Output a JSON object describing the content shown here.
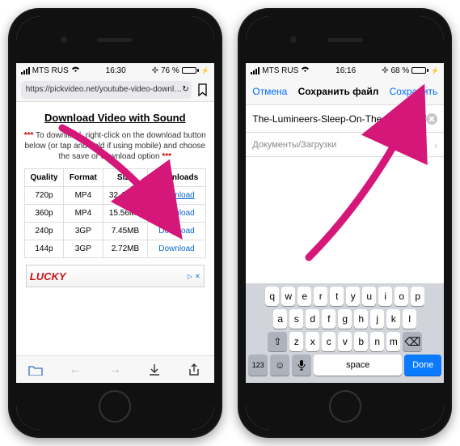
{
  "left": {
    "status": {
      "carrier": "MTS RUS",
      "time": "16:30",
      "battery_pct": "76 %",
      "battery_fill": 76
    },
    "url": "https://pickvideo.net/youtube-video-downl…",
    "heading": "Download Video with Sound",
    "stars": "***",
    "instructions": "To download, right-click on the download button below (or tap and hold if using mobile) and choose the save or download option",
    "columns": [
      "Quality",
      "Format",
      "Size",
      "Downloads"
    ],
    "rows": [
      {
        "quality": "720p",
        "format": "MP4",
        "size": "32.47MB",
        "link": "Download"
      },
      {
        "quality": "360p",
        "format": "MP4",
        "size": "15.56MB",
        "link": "Download"
      },
      {
        "quality": "240p",
        "format": "3GP",
        "size": "7.45MB",
        "link": "Download"
      },
      {
        "quality": "144p",
        "format": "3GP",
        "size": "2.72MB",
        "link": "Download"
      }
    ],
    "ad": {
      "brand": "LUCKY",
      "triangle": "▷",
      "x": "✕"
    }
  },
  "right": {
    "status": {
      "carrier": "MTS RUS",
      "time": "16:16",
      "battery_pct": "68 %",
      "battery_fill": 68
    },
    "nav": {
      "cancel": "Отмена",
      "title": "Сохранить файл",
      "save": "Сохранить"
    },
    "filename": "The-Lumineers-Sleep-On-The-Floor.mp4",
    "location": "Документы/Загрузки",
    "keyboard": {
      "row1": [
        "q",
        "w",
        "e",
        "r",
        "t",
        "y",
        "u",
        "i",
        "o",
        "p"
      ],
      "row2": [
        "a",
        "s",
        "d",
        "f",
        "g",
        "h",
        "j",
        "k",
        "l"
      ],
      "row3": [
        "z",
        "x",
        "c",
        "v",
        "b",
        "n",
        "m"
      ],
      "label123": "123",
      "space": "space",
      "done": "Done"
    }
  }
}
